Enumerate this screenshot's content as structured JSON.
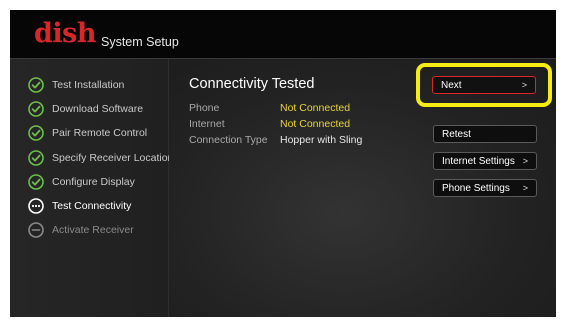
{
  "header": {
    "logo_text": "dish",
    "title": "System Setup"
  },
  "sidebar": {
    "steps": [
      {
        "label": "Test Installation",
        "status": "done",
        "icon": "check-circle-icon"
      },
      {
        "label": "Download Software",
        "status": "done",
        "icon": "check-circle-icon"
      },
      {
        "label": "Pair Remote Control",
        "status": "done",
        "icon": "check-circle-icon"
      },
      {
        "label": "Specify Receiver Location",
        "status": "done",
        "icon": "check-circle-icon"
      },
      {
        "label": "Configure Display",
        "status": "done",
        "icon": "check-circle-icon"
      },
      {
        "label": "Test Connectivity",
        "status": "current",
        "icon": "ellipsis-circle-icon"
      },
      {
        "label": "Activate Receiver",
        "status": "pending",
        "icon": "minus-circle-icon"
      }
    ]
  },
  "main": {
    "title": "Connectivity Tested",
    "rows": [
      {
        "key": "Phone",
        "value": "Not Connected",
        "state": "warn"
      },
      {
        "key": "Internet",
        "value": "Not Connected",
        "state": "warn"
      },
      {
        "key": "Connection Type",
        "value": "Hopper with Sling",
        "state": "ok"
      }
    ]
  },
  "actions": {
    "next": {
      "label": "Next",
      "arrow": ">"
    },
    "retest": {
      "label": "Retest"
    },
    "internet_settings": {
      "label": "Internet Settings",
      "arrow": ">"
    },
    "phone_settings": {
      "label": "Phone Settings",
      "arrow": ">"
    }
  },
  "colors": {
    "brand_red": "#d8272a",
    "check_green": "#6cc04a",
    "warning_yellow": "#e8d23a",
    "highlight_yellow": "#f4ec13"
  }
}
